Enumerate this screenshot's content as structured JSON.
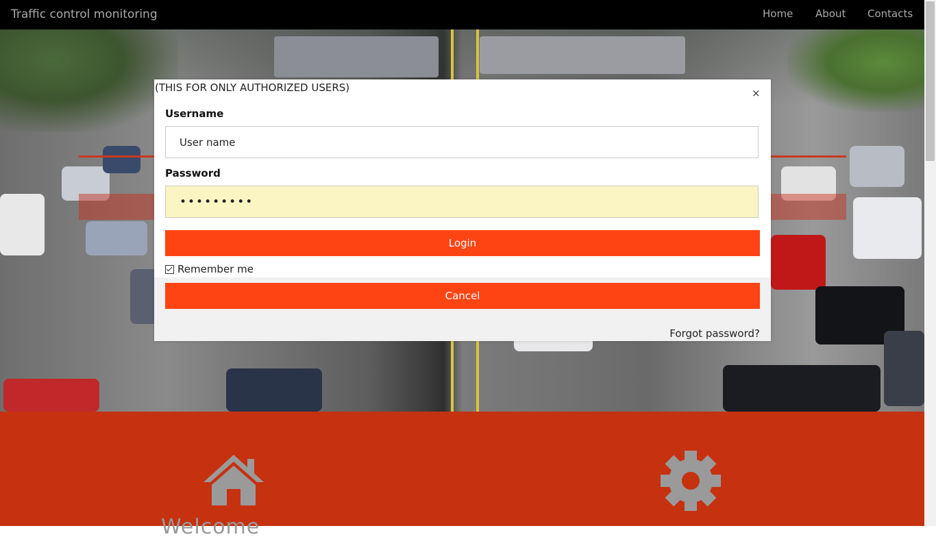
{
  "navbar": {
    "brand": "Traffic control monitoring",
    "links": [
      "Home",
      "About",
      "Contacts"
    ]
  },
  "modal": {
    "title": "(THIS FOR ONLY AUTHORIZED USERS)",
    "close_label": "×",
    "username_label": "Username",
    "username_value": "User name",
    "password_label": "Password",
    "password_value": "•••••••••",
    "login_label": "Login",
    "remember_label": "Remember me",
    "remember_checked": true,
    "cancel_label": "Cancel",
    "forgot_label": "Forgot password?"
  },
  "services": {
    "title_partial": "Welcome",
    "icons": [
      "home-icon",
      "gear-icon"
    ]
  },
  "colors": {
    "navbar_bg": "#000000",
    "accent_button": "#ff4414",
    "services_bg": "#c6310f",
    "password_bg": "#faf5c2"
  }
}
